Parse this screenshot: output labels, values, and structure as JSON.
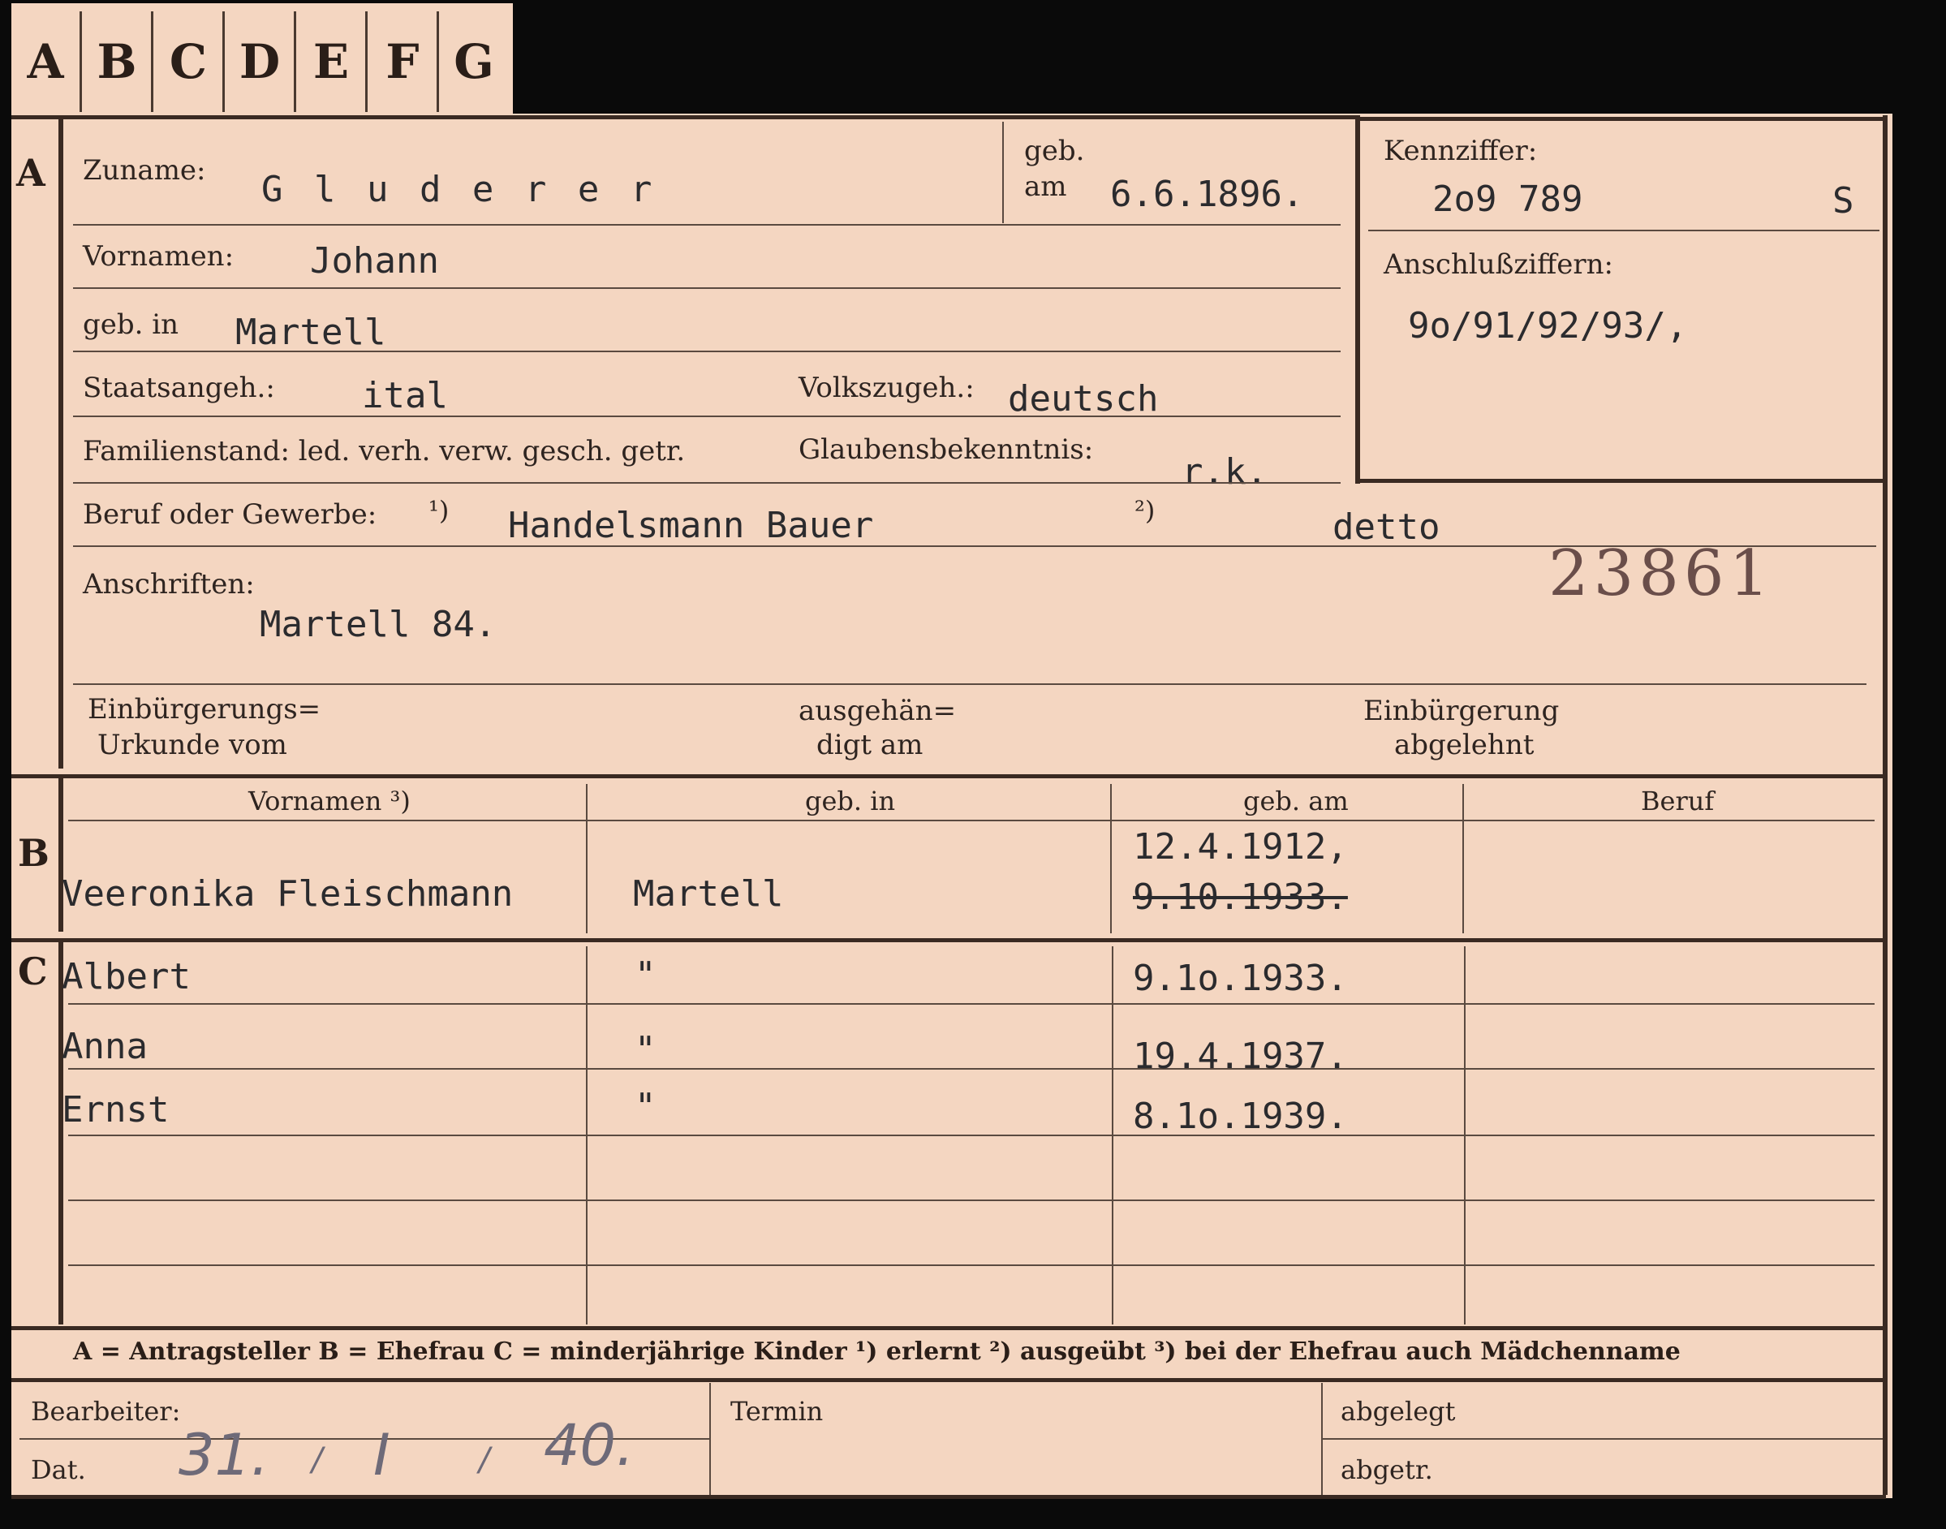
{
  "tabs": [
    "A",
    "B",
    "C",
    "D",
    "E",
    "F",
    "G"
  ],
  "sections": {
    "a": "A",
    "b": "B",
    "c": "C"
  },
  "labels": {
    "zuname": "Zuname:",
    "geb_am_1": "geb.",
    "geb_am_2": "am",
    "kennziffer": "Kennziffer:",
    "vornamen": "Vornamen:",
    "anschlussziffern": "Anschlußziffern:",
    "geb_in": "geb. in",
    "staatsangeh": "Staatsangeh.:",
    "volkszugeh": "Volkszugeh.:",
    "familienstand": "Familienstand: led. verh. verw. gesch. getr.",
    "glaubensbekenntnis": "Glaubensbekenntnis:",
    "beruf_oder_gewerbe": "Beruf oder Gewerbe:",
    "note1": "¹)",
    "note2": "²)",
    "anschriften": "Anschriften:",
    "einbuergerungs_1": "Einbürgerungs=",
    "einbuergerungs_2": "Urkunde vom",
    "ausgehaen_1": "ausgehän=",
    "ausgehaen_2": "digt am",
    "einbuergerung_1": "Einbürgerung",
    "einbuergerung_2": "abgelehnt",
    "col_vornamen": "Vornamen ³)",
    "col_geb_in": "geb. in",
    "col_geb_am": "geb. am",
    "col_beruf": "Beruf",
    "legend": "A = Antragsteller   B = Ehefrau   C = minderjährige Kinder  ¹) erlernt   ²) ausgeübt   ³) bei der Ehefrau auch Mädchenname",
    "bearbeiter": "Bearbeiter:",
    "dat": "Dat.",
    "termin": "Termin",
    "abgelegt": "abgelegt",
    "abgetr": "abgetr."
  },
  "values": {
    "zuname": "G l u d e r e r",
    "geb_am": "6.6.1896.",
    "kennziffer": "2o9 789",
    "kennziffer_suffix": "S",
    "vornamen": "Johann",
    "anschlussziffern": "9o/91/92/93/,",
    "geb_in": "Martell",
    "staatsangeh": "ital",
    "volkszugeh": "deutsch",
    "glaubensbekenntnis": "r.k.",
    "beruf_1": "Handelsmann Bauer",
    "beruf_2": "detto",
    "stamp_number": "23861",
    "anschrift": "Martell 84.",
    "date_hand_1": "31.",
    "date_hand_2": "I",
    "date_hand_3": "40.",
    "slash": "/"
  },
  "wife": {
    "vornamen": "Veeronika Fleischmann",
    "geb_in": "Martell",
    "geb_am": "12.4.1912,",
    "geb_am_struck": "9.10.1933."
  },
  "children": [
    {
      "vornamen": "Albert",
      "geb_in": "\"",
      "geb_am": "9.1o.1933."
    },
    {
      "vornamen": "Anna",
      "geb_in": "\"",
      "geb_am": "19.4.1937."
    },
    {
      "vornamen": "Ernst",
      "geb_in": "\"",
      "geb_am": "8.1o.1939."
    }
  ]
}
